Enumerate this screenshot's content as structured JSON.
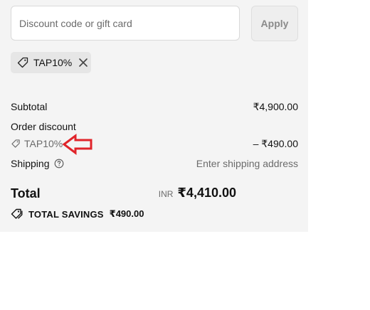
{
  "discount": {
    "placeholder": "Discount code or gift card",
    "apply_label": "Apply",
    "chip_code": "TAP10%"
  },
  "summary": {
    "subtotal_label": "Subtotal",
    "subtotal_value": "₹4,900.00",
    "order_discount_label": "Order discount",
    "discount_code": "TAP10%",
    "discount_value": "– ₹490.00",
    "shipping_label": "Shipping",
    "shipping_value": "Enter shipping address",
    "total_label": "Total",
    "total_currency": "INR",
    "total_value": "₹4,410.00",
    "savings_label": "TOTAL SAVINGS",
    "savings_value": "₹490.00"
  },
  "annotation": {
    "arrow_color": "#e0242a"
  },
  "icons": [
    "tag-icon",
    "close-icon",
    "help-circle-icon",
    "tags-icon"
  ]
}
